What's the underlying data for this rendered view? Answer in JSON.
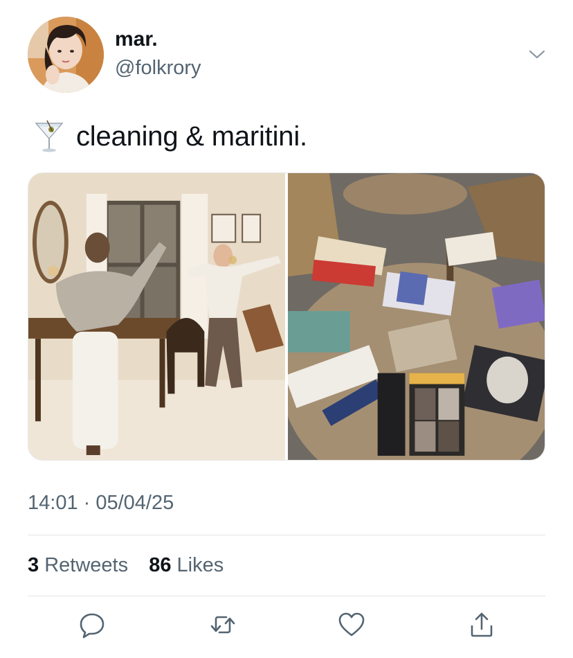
{
  "author": {
    "display_name": "mar.",
    "handle": "@folkrory"
  },
  "tweet": {
    "emoji_icon": "martini-glass-icon",
    "text": "cleaning & maritini."
  },
  "media": [
    {
      "name": "photo-dancing-in-dining-room"
    },
    {
      "name": "photo-books-on-table"
    }
  ],
  "timestamp": "14:01 · 05/04/25",
  "stats": {
    "retweets_count": "3",
    "retweets_label": "Retweets",
    "likes_count": "86",
    "likes_label": "Likes"
  },
  "actions": [
    {
      "icon": "reply-icon"
    },
    {
      "icon": "retweet-icon"
    },
    {
      "icon": "heart-icon"
    },
    {
      "icon": "share-icon"
    }
  ],
  "colors": {
    "text_primary": "#0f1419",
    "text_secondary": "#536471",
    "icon": "#536471",
    "divider": "#e1e4e8"
  }
}
